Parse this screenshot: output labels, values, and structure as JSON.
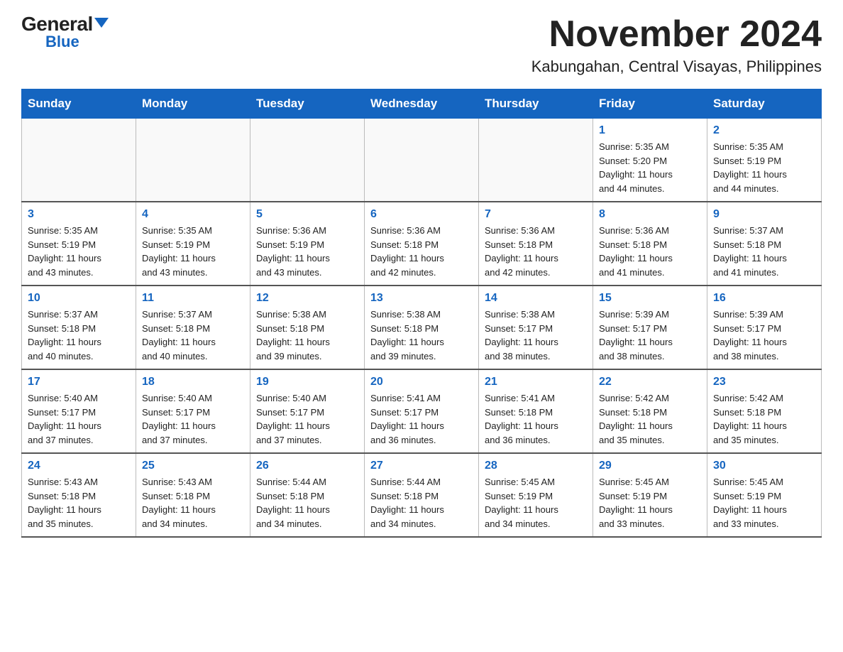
{
  "header": {
    "logo_general": "General",
    "logo_blue": "Blue",
    "title": "November 2024",
    "subtitle": "Kabungahan, Central Visayas, Philippines"
  },
  "calendar": {
    "days_of_week": [
      "Sunday",
      "Monday",
      "Tuesday",
      "Wednesday",
      "Thursday",
      "Friday",
      "Saturday"
    ],
    "weeks": [
      [
        {
          "day": "",
          "info": ""
        },
        {
          "day": "",
          "info": ""
        },
        {
          "day": "",
          "info": ""
        },
        {
          "day": "",
          "info": ""
        },
        {
          "day": "",
          "info": ""
        },
        {
          "day": "1",
          "info": "Sunrise: 5:35 AM\nSunset: 5:20 PM\nDaylight: 11 hours\nand 44 minutes."
        },
        {
          "day": "2",
          "info": "Sunrise: 5:35 AM\nSunset: 5:19 PM\nDaylight: 11 hours\nand 44 minutes."
        }
      ],
      [
        {
          "day": "3",
          "info": "Sunrise: 5:35 AM\nSunset: 5:19 PM\nDaylight: 11 hours\nand 43 minutes."
        },
        {
          "day": "4",
          "info": "Sunrise: 5:35 AM\nSunset: 5:19 PM\nDaylight: 11 hours\nand 43 minutes."
        },
        {
          "day": "5",
          "info": "Sunrise: 5:36 AM\nSunset: 5:19 PM\nDaylight: 11 hours\nand 43 minutes."
        },
        {
          "day": "6",
          "info": "Sunrise: 5:36 AM\nSunset: 5:18 PM\nDaylight: 11 hours\nand 42 minutes."
        },
        {
          "day": "7",
          "info": "Sunrise: 5:36 AM\nSunset: 5:18 PM\nDaylight: 11 hours\nand 42 minutes."
        },
        {
          "day": "8",
          "info": "Sunrise: 5:36 AM\nSunset: 5:18 PM\nDaylight: 11 hours\nand 41 minutes."
        },
        {
          "day": "9",
          "info": "Sunrise: 5:37 AM\nSunset: 5:18 PM\nDaylight: 11 hours\nand 41 minutes."
        }
      ],
      [
        {
          "day": "10",
          "info": "Sunrise: 5:37 AM\nSunset: 5:18 PM\nDaylight: 11 hours\nand 40 minutes."
        },
        {
          "day": "11",
          "info": "Sunrise: 5:37 AM\nSunset: 5:18 PM\nDaylight: 11 hours\nand 40 minutes."
        },
        {
          "day": "12",
          "info": "Sunrise: 5:38 AM\nSunset: 5:18 PM\nDaylight: 11 hours\nand 39 minutes."
        },
        {
          "day": "13",
          "info": "Sunrise: 5:38 AM\nSunset: 5:18 PM\nDaylight: 11 hours\nand 39 minutes."
        },
        {
          "day": "14",
          "info": "Sunrise: 5:38 AM\nSunset: 5:17 PM\nDaylight: 11 hours\nand 38 minutes."
        },
        {
          "day": "15",
          "info": "Sunrise: 5:39 AM\nSunset: 5:17 PM\nDaylight: 11 hours\nand 38 minutes."
        },
        {
          "day": "16",
          "info": "Sunrise: 5:39 AM\nSunset: 5:17 PM\nDaylight: 11 hours\nand 38 minutes."
        }
      ],
      [
        {
          "day": "17",
          "info": "Sunrise: 5:40 AM\nSunset: 5:17 PM\nDaylight: 11 hours\nand 37 minutes."
        },
        {
          "day": "18",
          "info": "Sunrise: 5:40 AM\nSunset: 5:17 PM\nDaylight: 11 hours\nand 37 minutes."
        },
        {
          "day": "19",
          "info": "Sunrise: 5:40 AM\nSunset: 5:17 PM\nDaylight: 11 hours\nand 37 minutes."
        },
        {
          "day": "20",
          "info": "Sunrise: 5:41 AM\nSunset: 5:17 PM\nDaylight: 11 hours\nand 36 minutes."
        },
        {
          "day": "21",
          "info": "Sunrise: 5:41 AM\nSunset: 5:18 PM\nDaylight: 11 hours\nand 36 minutes."
        },
        {
          "day": "22",
          "info": "Sunrise: 5:42 AM\nSunset: 5:18 PM\nDaylight: 11 hours\nand 35 minutes."
        },
        {
          "day": "23",
          "info": "Sunrise: 5:42 AM\nSunset: 5:18 PM\nDaylight: 11 hours\nand 35 minutes."
        }
      ],
      [
        {
          "day": "24",
          "info": "Sunrise: 5:43 AM\nSunset: 5:18 PM\nDaylight: 11 hours\nand 35 minutes."
        },
        {
          "day": "25",
          "info": "Sunrise: 5:43 AM\nSunset: 5:18 PM\nDaylight: 11 hours\nand 34 minutes."
        },
        {
          "day": "26",
          "info": "Sunrise: 5:44 AM\nSunset: 5:18 PM\nDaylight: 11 hours\nand 34 minutes."
        },
        {
          "day": "27",
          "info": "Sunrise: 5:44 AM\nSunset: 5:18 PM\nDaylight: 11 hours\nand 34 minutes."
        },
        {
          "day": "28",
          "info": "Sunrise: 5:45 AM\nSunset: 5:19 PM\nDaylight: 11 hours\nand 34 minutes."
        },
        {
          "day": "29",
          "info": "Sunrise: 5:45 AM\nSunset: 5:19 PM\nDaylight: 11 hours\nand 33 minutes."
        },
        {
          "day": "30",
          "info": "Sunrise: 5:45 AM\nSunset: 5:19 PM\nDaylight: 11 hours\nand 33 minutes."
        }
      ]
    ]
  },
  "colors": {
    "header_bg": "#1565c0",
    "accent": "#1565c0",
    "day_number": "#1565c0"
  }
}
